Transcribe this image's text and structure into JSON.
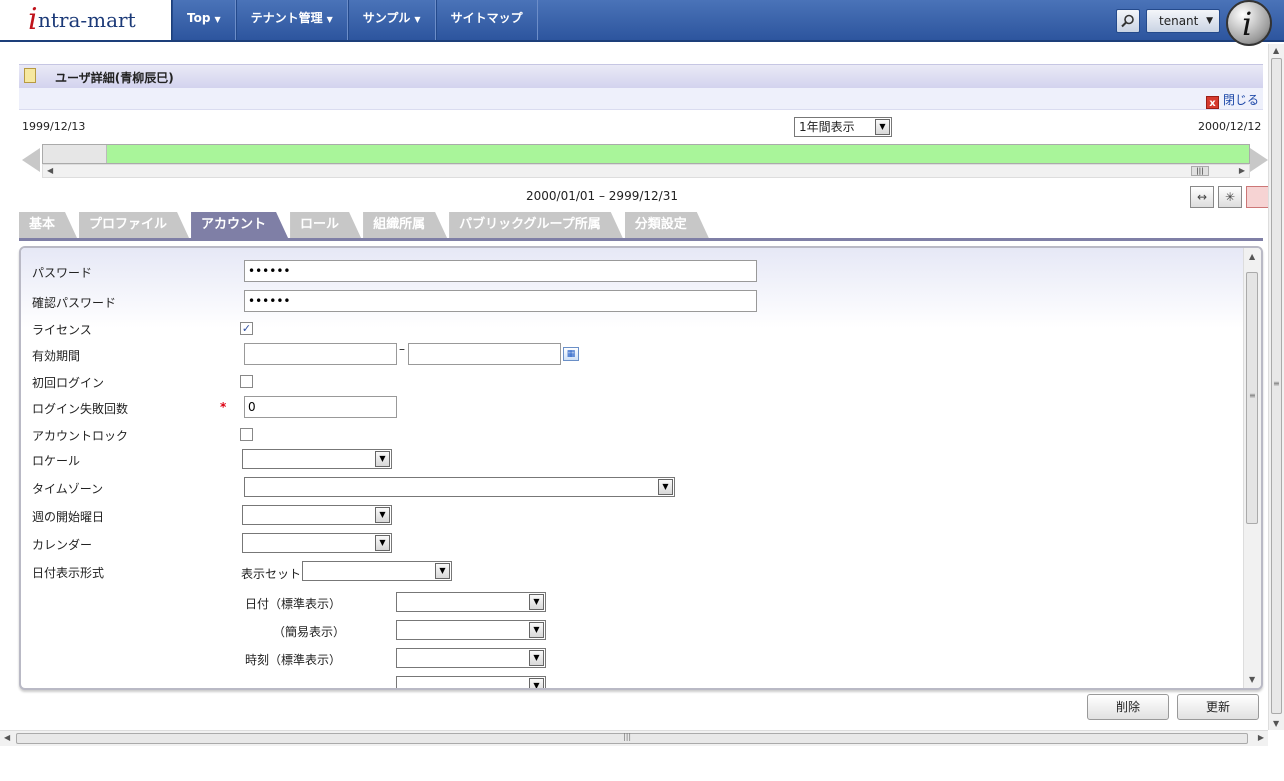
{
  "header": {
    "logo_i": "i",
    "logo_text": "ntra-mart",
    "nav": [
      {
        "label": "Top"
      },
      {
        "label": "テナント管理"
      },
      {
        "label": "サンプル"
      },
      {
        "label": "サイトマップ"
      }
    ],
    "caret": "▼",
    "tenant_label": "tenant",
    "user_icon_letter": "i"
  },
  "page": {
    "title": "ユーザ詳細(青柳辰巳)",
    "close_label": "閉じる",
    "close_glyph": "x"
  },
  "timeline": {
    "start_date": "1999/12/13",
    "end_date": "2000/12/12",
    "period_select": "1年間表示",
    "range": "2000/01/01 – 2999/12/31"
  },
  "tabs": [
    {
      "label": "基本",
      "active": false
    },
    {
      "label": "プロファイル",
      "active": false
    },
    {
      "label": "アカウント",
      "active": true
    },
    {
      "label": "ロール",
      "active": false
    },
    {
      "label": "組織所属",
      "active": false
    },
    {
      "label": "パブリックグループ所属",
      "active": false
    },
    {
      "label": "分類設定",
      "active": false
    }
  ],
  "form": {
    "password_label": "パスワード",
    "password_value": "••••••",
    "confirm_password_label": "確認パスワード",
    "confirm_password_value": "••••••",
    "license_label": "ライセンス",
    "license_checked": true,
    "validity_label": "有効期間",
    "validity_dash": "–",
    "first_login_label": "初回ログイン",
    "login_fail_label": "ログイン失敗回数",
    "login_fail_value": "0",
    "required_mark": "*",
    "account_lock_label": "アカウントロック",
    "locale_label": "ロケール",
    "timezone_label": "タイムゾーン",
    "week_start_label": "週の開始曜日",
    "calendar_label": "カレンダー",
    "date_format_label": "日付表示形式",
    "display_set_label": "表示セット",
    "date_standard_label": "日付（標準表示）",
    "date_simple_label": "（簡易表示）",
    "time_standard_label": "時刻（標準表示）",
    "check_glyph": "✓"
  },
  "buttons": {
    "delete": "削除",
    "update": "更新"
  }
}
